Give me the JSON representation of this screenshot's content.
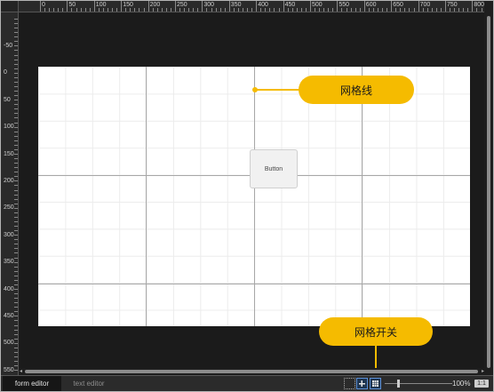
{
  "ruler": {
    "top_labels": [
      "0",
      "50",
      "100",
      "150",
      "200",
      "250",
      "300",
      "350",
      "400",
      "450",
      "500",
      "550",
      "600",
      "650",
      "700",
      "750",
      "800"
    ],
    "left_labels": [
      "-50",
      "0",
      "50",
      "100",
      "150",
      "200",
      "250",
      "300",
      "350",
      "400",
      "450",
      "500",
      "550"
    ]
  },
  "form": {
    "button_label": "Button"
  },
  "callouts": {
    "gridlines": "网格线",
    "grid_switch": "网格开关"
  },
  "tabs": [
    {
      "label": "form editor",
      "active": true
    },
    {
      "label": "text editor",
      "active": false
    }
  ],
  "toolbar": {
    "icons": [
      "selection-icon",
      "snap-icon",
      "grid-icon"
    ],
    "zoom_text": "100%",
    "zoom_level": 1.0,
    "actual_size_label": "1:1"
  },
  "colors": {
    "accent": "#f5bb00",
    "background": "#1e1e1e",
    "form_background": "#ffffff"
  }
}
